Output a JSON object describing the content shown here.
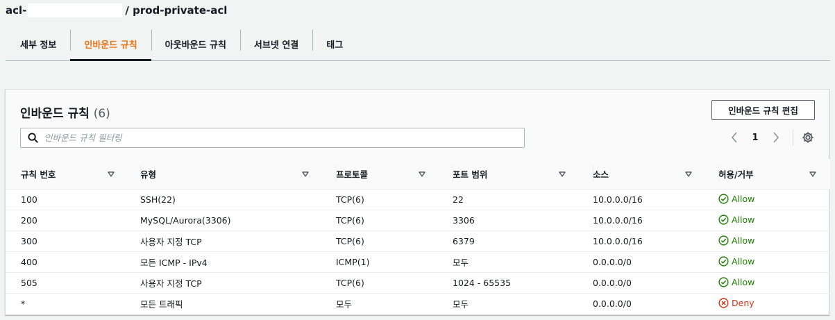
{
  "header": {
    "prefix": "acl-",
    "name": "/ prod-private-acl"
  },
  "tabs": [
    {
      "label": "세부 정보",
      "active": false
    },
    {
      "label": "인바운드 규칙",
      "active": true
    },
    {
      "label": "아웃바운드 규칙",
      "active": false
    },
    {
      "label": "서브넷 연결",
      "active": false
    },
    {
      "label": "태그",
      "active": false
    }
  ],
  "panel": {
    "title": "인바운드 규칙",
    "count": "(6)",
    "edit_button": "인바운드 규칙 편집",
    "search_placeholder": "인바운드 규칙 필터링",
    "page": "1"
  },
  "table": {
    "columns": [
      "규칙 번호",
      "유형",
      "프로토콜",
      "포트 범위",
      "소스",
      "허용/거부"
    ],
    "rows": [
      {
        "rule": "100",
        "type": "SSH(22)",
        "protocol": "TCP(6)",
        "port": "22",
        "source": "10.0.0.0/16",
        "action": "Allow"
      },
      {
        "rule": "200",
        "type": "MySQL/Aurora(3306)",
        "protocol": "TCP(6)",
        "port": "3306",
        "source": "10.0.0.0/16",
        "action": "Allow"
      },
      {
        "rule": "300",
        "type": "사용자 지정 TCP",
        "protocol": "TCP(6)",
        "port": "6379",
        "source": "10.0.0.0/16",
        "action": "Allow"
      },
      {
        "rule": "400",
        "type": "모든 ICMP - IPv4",
        "protocol": "ICMP(1)",
        "port": "모두",
        "source": "0.0.0.0/0",
        "action": "Allow"
      },
      {
        "rule": "505",
        "type": "사용자 지정 TCP",
        "protocol": "TCP(6)",
        "port": "1024 - 65535",
        "source": "0.0.0.0/0",
        "action": "Allow"
      },
      {
        "rule": "*",
        "type": "모든 트래픽",
        "protocol": "모두",
        "port": "모두",
        "source": "0.0.0.0/0",
        "action": "Deny"
      }
    ]
  },
  "colors": {
    "accent": "#ec7211",
    "allow": "#1d8102",
    "deny": "#d13212"
  }
}
